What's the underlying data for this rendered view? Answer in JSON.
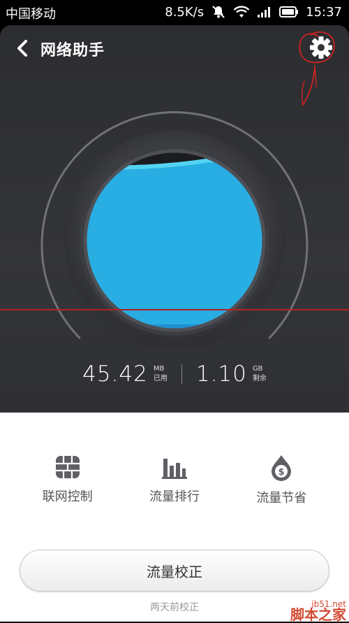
{
  "status_bar": {
    "carrier": "中国移动",
    "net_speed": "8.5K/s",
    "time": "15:37",
    "icons": [
      "mute-icon",
      "wifi-icon",
      "signal-icon",
      "battery-icon"
    ]
  },
  "header": {
    "back_icon": "chevron-left-icon",
    "title": "网络助手",
    "settings_icon": "gear-icon"
  },
  "usage": {
    "used_value": "45.42",
    "used_unit": "MB",
    "used_label": "已用",
    "remaining_value": "1.10",
    "remaining_unit": "GB",
    "remaining_label": "剩余",
    "fill_fraction": 0.96
  },
  "features": [
    {
      "label": "联网控制",
      "icon": "firewall-icon"
    },
    {
      "label": "流量排行",
      "icon": "bar-chart-icon"
    },
    {
      "label": "流量节省",
      "icon": "money-drop-icon"
    }
  ],
  "calibrate": {
    "button_label": "流量校正",
    "hint": "两天前校正"
  },
  "watermark": {
    "site": "jb51.net",
    "name": "脚本之家"
  },
  "colors": {
    "panel": "#2f3034",
    "water": "#29aee3",
    "water_highlight": "#54d3f2",
    "annotation": "#d0221f"
  }
}
